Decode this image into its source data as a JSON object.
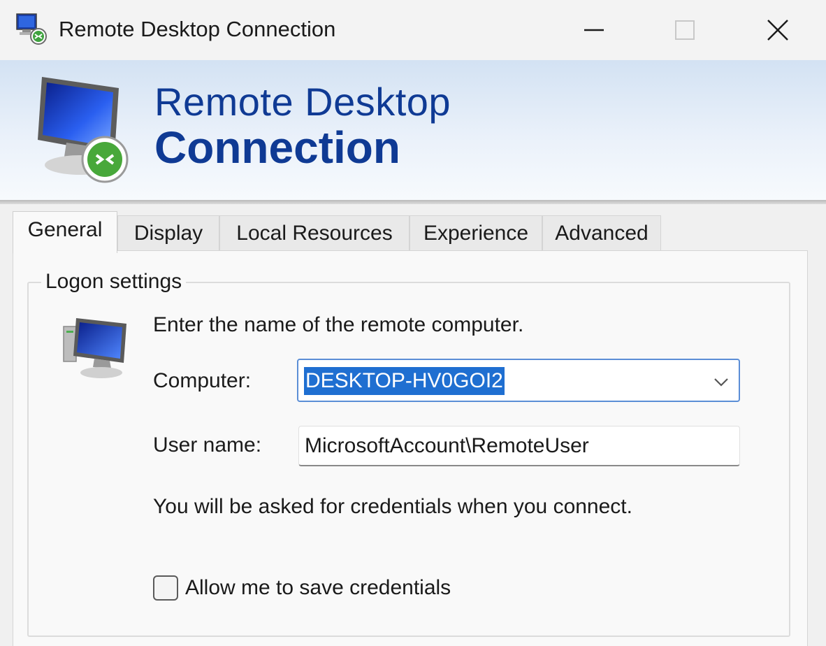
{
  "window": {
    "title": "Remote Desktop Connection",
    "controls": {
      "minimize": "minimize",
      "maximize": "maximize",
      "close": "close"
    }
  },
  "banner": {
    "line1": "Remote Desktop",
    "line2": "Connection",
    "accent_color": "#0f3a94"
  },
  "tabs": [
    {
      "label": "General",
      "active": true
    },
    {
      "label": "Display",
      "active": false
    },
    {
      "label": "Local Resources",
      "active": false
    },
    {
      "label": "Experience",
      "active": false
    },
    {
      "label": "Advanced",
      "active": false
    }
  ],
  "logon": {
    "group_title": "Logon settings",
    "prompt": "Enter the name of the remote computer.",
    "computer_label": "Computer:",
    "computer_value": "DESKTOP-HV0GOI2",
    "username_label": "User name:",
    "username_value": "MicrosoftAccount\\RemoteUser",
    "credentials_note": "You will be asked for credentials when you connect.",
    "save_credentials_label": "Allow me to save credentials",
    "save_credentials_checked": false
  },
  "icons": {
    "app": "remote-desktop-icon",
    "banner": "monitor-connection-icon",
    "logon": "computer-icon",
    "dropdown": "chevron-down-icon"
  }
}
